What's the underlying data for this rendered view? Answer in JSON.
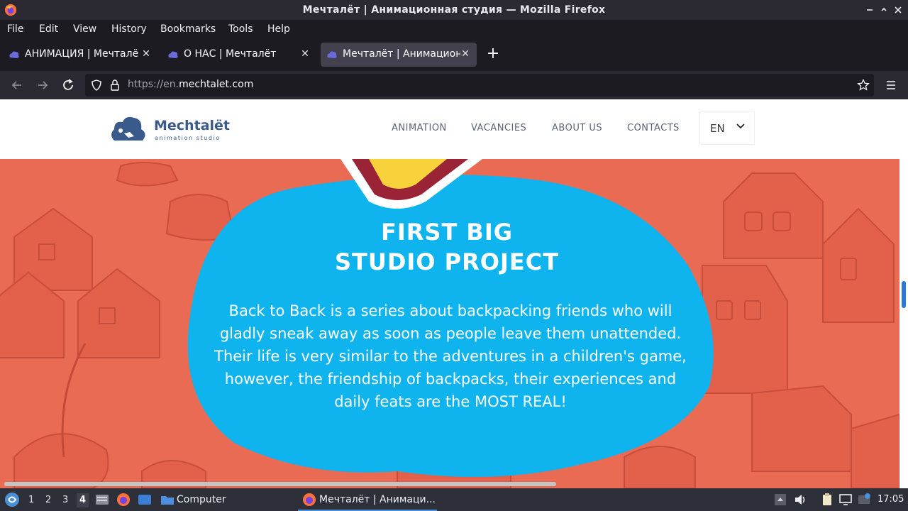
{
  "window": {
    "title": "Мечталёт | Анимационная студия — Mozilla Firefox",
    "controls": [
      "minimize",
      "maximize",
      "close"
    ]
  },
  "menubar": {
    "items": [
      "File",
      "Edit",
      "View",
      "History",
      "Bookmarks",
      "Tools",
      "Help"
    ]
  },
  "tabs": [
    {
      "label": "АНИМАЦИЯ | Мечталёт",
      "active": false
    },
    {
      "label": "О НАС | Мечталёт",
      "active": false
    },
    {
      "label": "Мечталёт | Анимационная",
      "active": true
    }
  ],
  "navbar": {
    "url_prefix": "https://en.",
    "url_domain": "mechtalet.com"
  },
  "site": {
    "logo_name": "Mechtalët",
    "logo_tagline": "animation studio",
    "nav": [
      "ANIMATION",
      "VACANCIES",
      "ABOUT US",
      "CONTACTS"
    ],
    "lang": "EN",
    "hero_title_line1": "FIRST BIG",
    "hero_title_line2": "STUDIO PROJECT",
    "hero_text": "Back to Back is a series about backpacking friends who will gladly sneak away as soon as people leave them unattended. Their life is very similar to the adventures in a children's game, however, the friendship of backpacks, their experiences and daily feats are the MOST REAL!"
  },
  "colors": {
    "hero_bg": "#ea6b54",
    "blob": "#0fb4ef",
    "logo": "#3a5a8c",
    "accent": "#2979d9"
  },
  "taskbar": {
    "workspaces": [
      "1",
      "2",
      "3",
      "4"
    ],
    "current_workspace": "4",
    "folder_label": "Computer",
    "task_label": "Мечталёт | Анимаци...",
    "clock": "17:05"
  }
}
